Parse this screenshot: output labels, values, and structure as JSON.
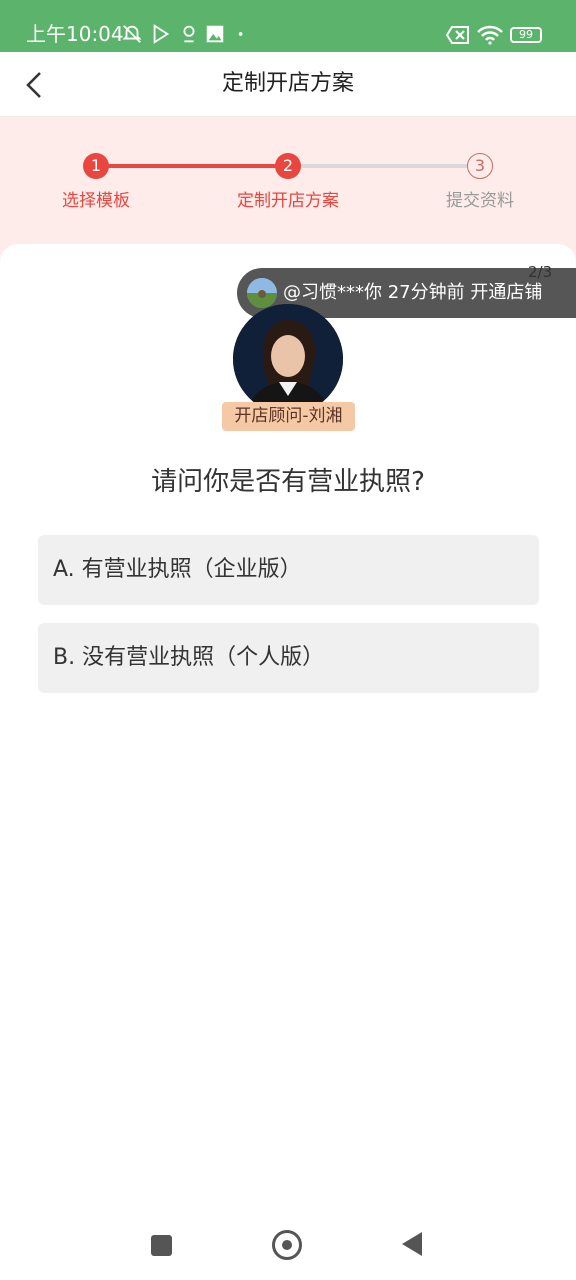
{
  "status_bar": {
    "time": "上午10:04",
    "battery": "99",
    "icons": [
      "muted-alarm-icon",
      "play-store-icon",
      "location-icon",
      "photo-icon",
      "dot-icon",
      "battery-x-icon",
      "wifi-icon",
      "battery-icon"
    ],
    "colors": {
      "background": "#5cb46c"
    }
  },
  "header": {
    "title": "定制开店方案",
    "back_icon": "chevron-left-icon"
  },
  "steps": [
    {
      "number": "1",
      "label": "选择模板",
      "state": "done"
    },
    {
      "number": "2",
      "label": "定制开店方案",
      "state": "current"
    },
    {
      "number": "3",
      "label": "提交资料",
      "state": "pending"
    }
  ],
  "ticker": {
    "text": "@习惯***你 27分钟前 开通店铺",
    "pager": "2/3"
  },
  "advisor": {
    "label": "开店顾问-刘湘"
  },
  "question": "请问你是否有营业执照?",
  "options": [
    {
      "label": "A. 有营业执照（企业版）"
    },
    {
      "label": "B. 没有营业执照（个人版）"
    }
  ],
  "bottom_nav": {
    "icons": [
      "recents-square-icon",
      "home-circle-icon",
      "back-triangle-icon"
    ]
  },
  "colors": {
    "accent": "#e9463f",
    "step_band": "#fdecea",
    "option_bg": "#f0f0f0",
    "advisor_tag": "#f6c9a6"
  }
}
